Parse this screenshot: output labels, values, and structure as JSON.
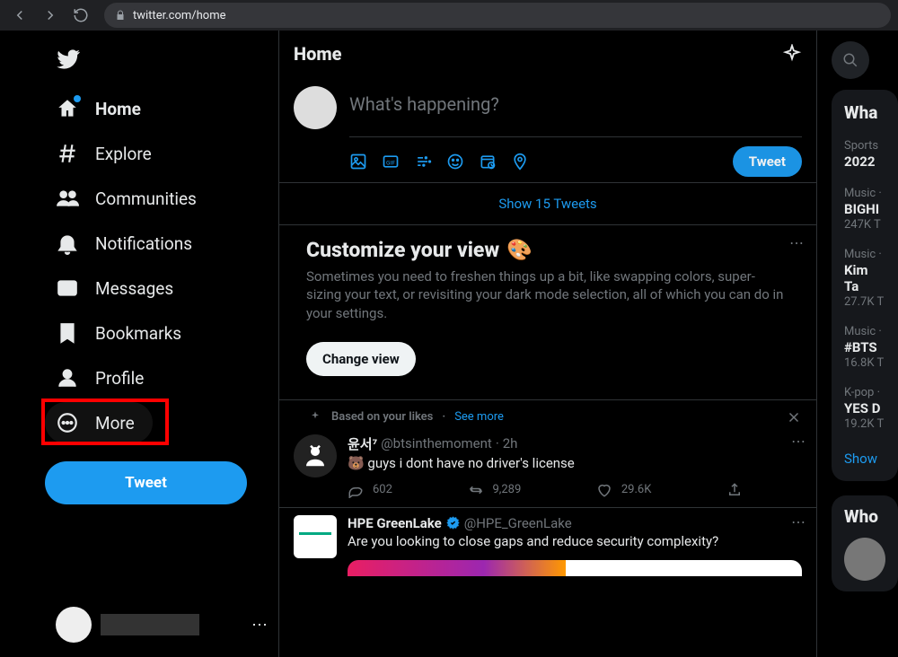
{
  "browser": {
    "url": "twitter.com/home"
  },
  "sidebar": {
    "items": [
      {
        "label": "Home",
        "active": true,
        "has_dot": true
      },
      {
        "label": "Explore"
      },
      {
        "label": "Communities"
      },
      {
        "label": "Notifications"
      },
      {
        "label": "Messages"
      },
      {
        "label": "Bookmarks"
      },
      {
        "label": "Profile"
      },
      {
        "label": "More",
        "highlighted": true
      }
    ],
    "tweet_button": "Tweet"
  },
  "header": {
    "title": "Home"
  },
  "compose": {
    "placeholder": "What's happening?",
    "tweet_button": "Tweet"
  },
  "show_tweets": "Show 15 Tweets",
  "customize": {
    "title": "Customize your view",
    "emoji": "🎨",
    "body": "Sometimes you need to freshen things up a bit, like swapping colors, super-sizing your text, or revisiting your dark mode selection, all of which you can do in your settings.",
    "button": "Change view"
  },
  "feed_context": {
    "label": "Based on your likes",
    "see_more": "See more"
  },
  "tweets": [
    {
      "name": "윤서⁷",
      "handle": "@btsinthemoment",
      "time": "2h",
      "text": "🐻 guys i dont have no driver's license",
      "replies": "602",
      "retweets": "9,289",
      "likes": "29.6K"
    },
    {
      "name": "HPE GreenLake",
      "verified": true,
      "handle": "@HPE_GreenLake",
      "text": "Are you looking to close gaps and reduce security complexity?"
    }
  ],
  "right": {
    "trends_title": "Wha",
    "trends": [
      {
        "ctx": "Sports",
        "title": "2022",
        "count": ""
      },
      {
        "ctx": "Music ·",
        "title": "BIGHI",
        "count": "247K T"
      },
      {
        "ctx": "Music ·",
        "title": "Kim Ta",
        "count": "27.7K T"
      },
      {
        "ctx": "Music ·",
        "title": "#BTS",
        "count": "16.8K T"
      },
      {
        "ctx": "K-pop ·",
        "title": "YES D",
        "count": "19.2K T"
      }
    ],
    "show_more": "Show",
    "who_title": "Who"
  }
}
